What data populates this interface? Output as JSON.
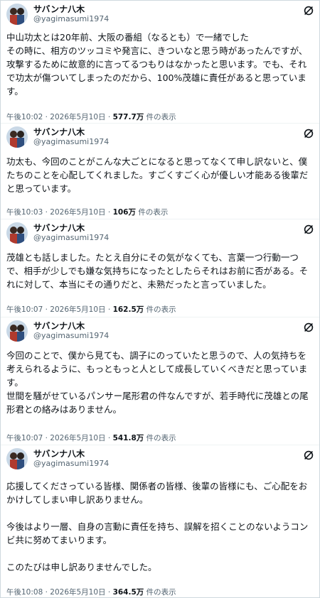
{
  "account": {
    "name": "サバンナ八木",
    "handle": "@yagimasumi1974"
  },
  "posts": [
    {
      "text": "中山功太とは20年前、大阪の番組（なるとも）で一緒でした\nその時に、相方のツッコミや発言に、きついなと思う時があったんですが、攻撃するために故意的に言ってるつもりはなかったと思います。でも、それで功太が傷ついてしまったのだから、100%茂雄に責任があると思っています。",
      "time": "午後10:02 · 2026年5月10日 · ",
      "views": "577.7万",
      "views_suffix": " 件の表示"
    },
    {
      "text": "功太も、今回のことがこんな大ごとになると思ってなくて申し訳ないと、僕たちのことを心配してくれました。すごくすごく心が優しい才能ある後輩だと思っています。",
      "time": "午後10:03 · 2026年5月10日 · ",
      "views": "106万",
      "views_suffix": " 件の表示"
    },
    {
      "text": "茂雄とも話しました。たとえ自分にその気がなくても、言葉一つ行動一つで、相手が少しでも嫌な気持ちになったとしたらそれはお前に否がある。それに対して、本当にその通りだと、未熟だったと言っていました。",
      "time": "午後10:07 · 2026年5月10日 · ",
      "views": "162.5万",
      "views_suffix": " 件の表示"
    },
    {
      "text": "今回のことで、僕から見ても、調子にのっていたと思うので、人の気持ちを考えられるように、もっともっと人として成長していくべきだと思っています。\n世間を騒がせているパンサー尾形君の件なんですが、若手時代に茂雄との尾形君との絡みはありません。",
      "time": "午後10:07 · 2026年5月10日 · ",
      "views": "541.8万",
      "views_suffix": " 件の表示"
    },
    {
      "text": "応援してくださっている皆様、関係者の皆様、後輩の皆様にも、ご心配をおかけしてしまい申し訳ありません。\n\n今後はより一層、自身の言動に責任を持ち、誤解を招くことのないようコンビ共に努めてまいります。\n\nこのたびは申し訳ありませんでした。",
      "time": "午後10:08 · 2026年5月10日 · ",
      "views": "364.5万",
      "views_suffix": " 件の表示"
    }
  ]
}
